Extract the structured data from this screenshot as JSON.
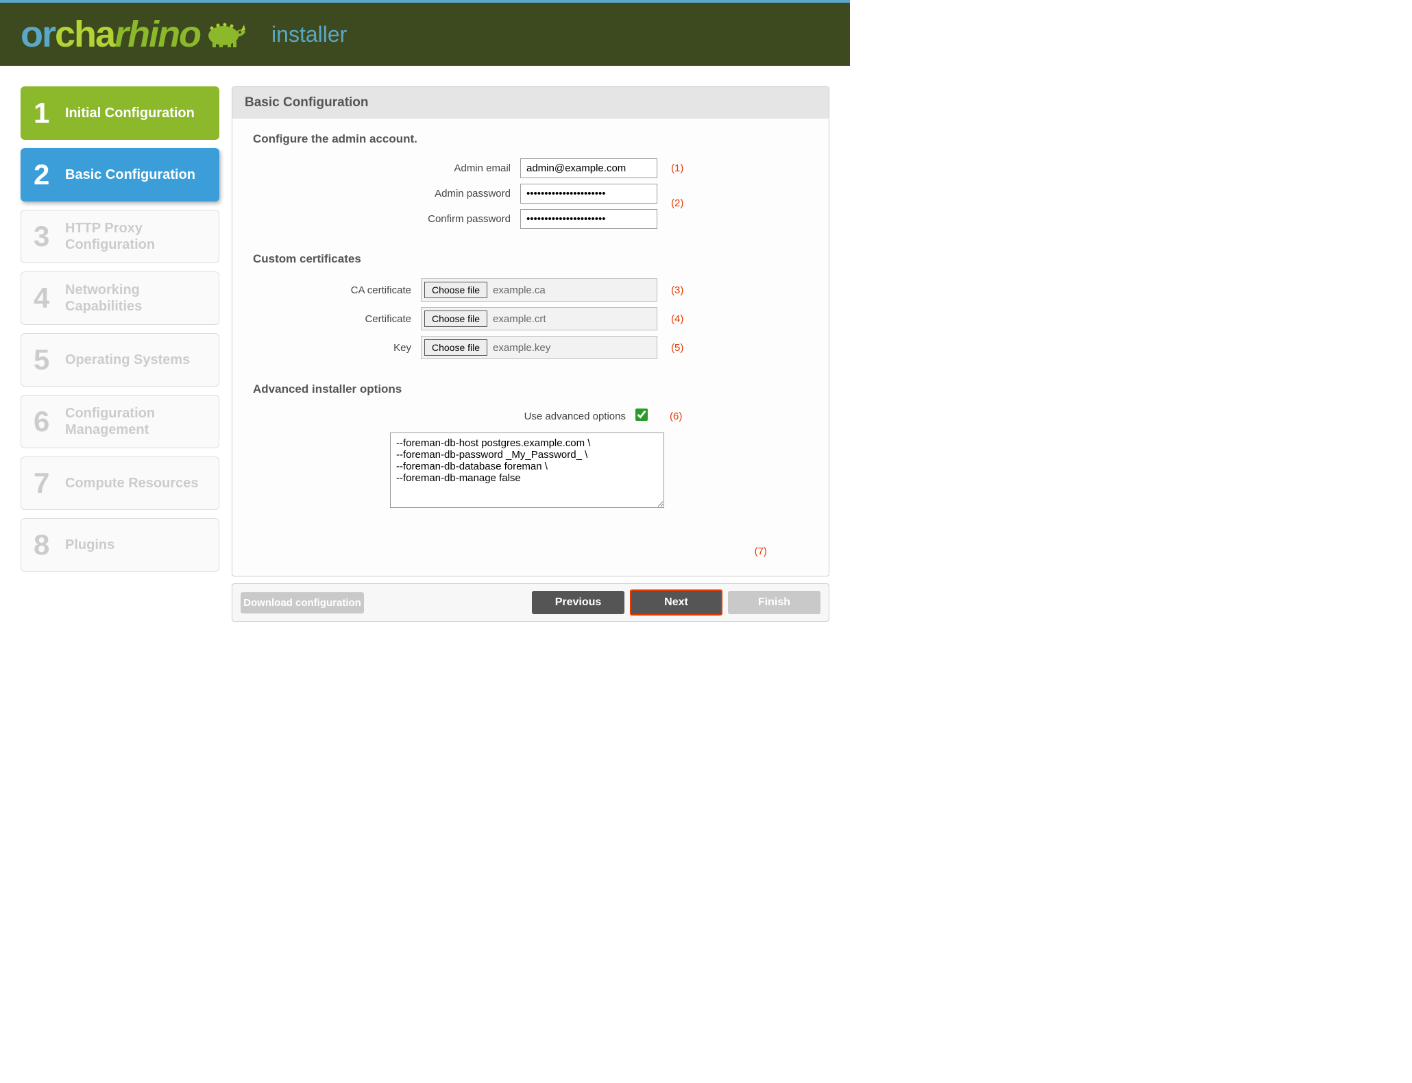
{
  "header": {
    "installer_label": "installer"
  },
  "sidebar": {
    "steps": [
      {
        "num": "1",
        "label": "Initial Configuration"
      },
      {
        "num": "2",
        "label": "Basic Configuration"
      },
      {
        "num": "3",
        "label": "HTTP Proxy Configuration"
      },
      {
        "num": "4",
        "label": "Networking Capabilities"
      },
      {
        "num": "5",
        "label": "Operating Systems"
      },
      {
        "num": "6",
        "label": "Configuration Management"
      },
      {
        "num": "7",
        "label": "Compute Resources"
      },
      {
        "num": "8",
        "label": "Plugins"
      }
    ]
  },
  "panel": {
    "title": "Basic Configuration",
    "admin_section_title": "Configure the admin account.",
    "admin_email_label": "Admin email",
    "admin_email_value": "admin@example.com",
    "admin_password_label": "Admin password",
    "admin_password_value": "••••••••••••••••••••••",
    "confirm_password_label": "Confirm password",
    "confirm_password_value": "••••••••••••••••••••••",
    "certs_section_title": "Custom certificates",
    "ca_label": "CA certificate",
    "cert_label": "Certificate",
    "key_label": "Key",
    "choose_file": "Choose file",
    "ca_file": "example.ca",
    "cert_file": "example.crt",
    "key_file": "example.key",
    "advanced_section_title": "Advanced installer options",
    "use_advanced_label": "Use advanced options",
    "advanced_text": "--foreman-db-host postgres.example.com \\\n--foreman-db-password _My_Password_ \\\n--foreman-db-database foreman \\\n--foreman-db-manage false"
  },
  "annotations": {
    "a1": "(1)",
    "a2": "(2)",
    "a3": "(3)",
    "a4": "(4)",
    "a5": "(5)",
    "a6": "(6)",
    "a7": "(7)"
  },
  "nav": {
    "download": "Download configuration",
    "previous": "Previous",
    "next": "Next",
    "finish": "Finish"
  }
}
